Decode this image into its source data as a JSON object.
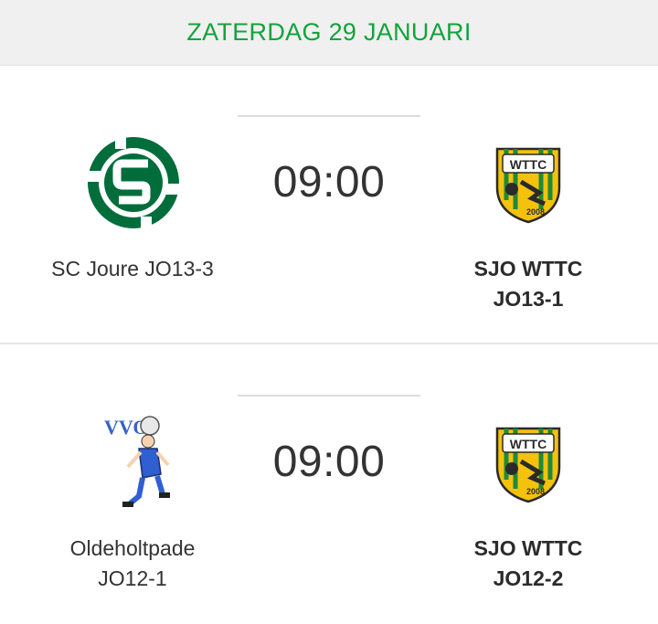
{
  "day_header": {
    "title": "ZATERDAG 29 JANUARI"
  },
  "matches": [
    {
      "time": "09:00",
      "home": {
        "name": "SC Joure JO13-3",
        "logo": "sc-joure-logo-icon"
      },
      "away": {
        "name_line1": "SJO WTTC",
        "name_line2": "JO13-1",
        "logo": "wttc-logo-icon",
        "logo_text": "WTTC",
        "logo_year": "2008"
      }
    },
    {
      "time": "09:00",
      "home": {
        "name_line1": "Oldeholtpade",
        "name_line2": "JO12-1",
        "logo": "vvo-logo-icon",
        "logo_text": "VVO"
      },
      "away": {
        "name_line1": "SJO WTTC",
        "name_line2": "JO12-2",
        "logo": "wttc-logo-icon",
        "logo_text": "WTTC",
        "logo_year": "2008"
      }
    }
  ],
  "colors": {
    "accent": "#12a33c",
    "sc_joure_green": "#006d3a",
    "wttc_yellow": "#f4c20d",
    "wttc_green": "#1e8a3a"
  }
}
